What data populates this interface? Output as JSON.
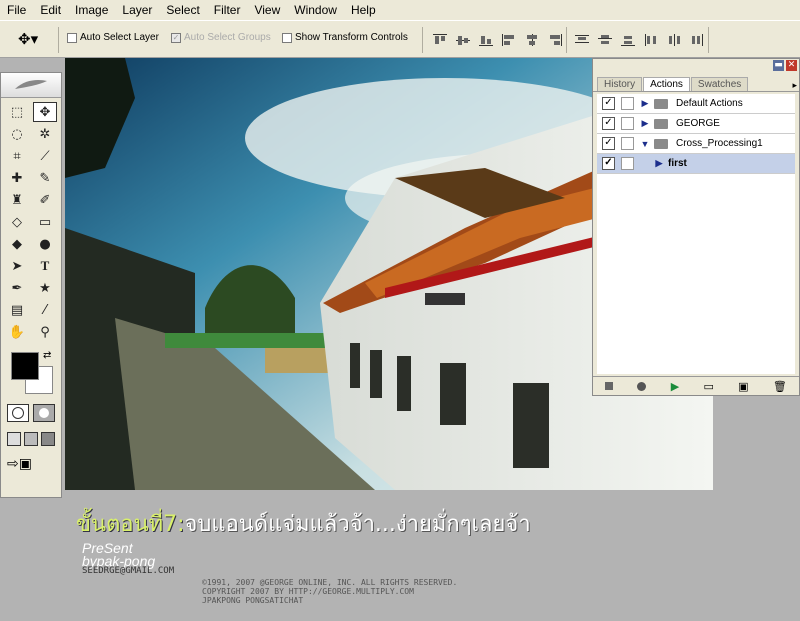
{
  "menu": [
    "File",
    "Edit",
    "Image",
    "Layer",
    "Select",
    "Filter",
    "View",
    "Window",
    "Help"
  ],
  "options": {
    "auto_select_layer": "Auto Select Layer",
    "auto_select_groups": "Auto Select Groups",
    "show_transform_controls": "Show Transform Controls"
  },
  "panel": {
    "tabs": [
      "History",
      "Actions",
      "Swatches"
    ],
    "actions": [
      {
        "label": "Default Actions",
        "expanded": false
      },
      {
        "label": "GEORGE",
        "expanded": false
      },
      {
        "label": "Cross_Processing1",
        "expanded": true
      },
      {
        "label": "first",
        "expanded": false,
        "selected": true
      }
    ]
  },
  "caption": {
    "step": "ขั้นตอนที่7:",
    "text": "จบแอนด์แจ่มแล้วจ้า...ง่ายมั่กๆเลยจ้า"
  },
  "present": {
    "line1": "PreSent",
    "line2": "bypak-pong",
    "email": "SEEDRGE@GMAIL.COM"
  },
  "copyright": [
    "©1991, 2007 @GEORGE ONLINE, INC. ALL RIGHTS RESERVED.",
    "COPYRIGHT 2007 BY  HTTP://GEORGE.MULTIPLY.COM",
    "JPAKPONG PONGSATICHAT"
  ],
  "colors": {
    "ui_bg": "#ece9d8",
    "caption_accent": "#d9f06b",
    "selected_row": "#c4d0e8"
  }
}
